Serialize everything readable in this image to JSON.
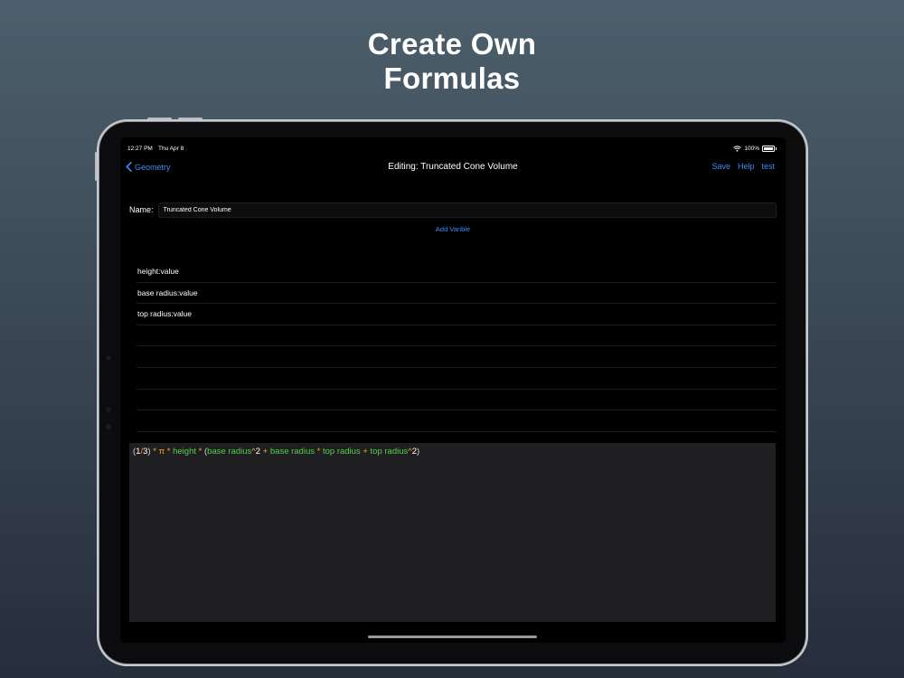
{
  "headline": {
    "line1": "Create Own",
    "line2": "Formulas"
  },
  "status_bar": {
    "time": "12:27 PM",
    "date": "Thu Apr 8",
    "battery": "100%"
  },
  "nav": {
    "back_label": "Geometry",
    "title": "Editing: Truncated Cone Volume",
    "actions": {
      "save": "Save",
      "help": "Help",
      "test": "test"
    }
  },
  "form": {
    "name_label": "Name:",
    "name_value": "Truncated Cone Volume",
    "add_variable": "Add Varible"
  },
  "variables": [
    {
      "label": "height:value"
    },
    {
      "label": "base radius:value"
    },
    {
      "label": "top radius:value"
    },
    {
      "label": ""
    },
    {
      "label": ""
    },
    {
      "label": ""
    },
    {
      "label": ""
    },
    {
      "label": ""
    }
  ],
  "formula": {
    "tokens": [
      {
        "text": "(",
        "kind": "paren"
      },
      {
        "text": "1",
        "kind": "num"
      },
      {
        "text": "/",
        "kind": "op"
      },
      {
        "text": "3",
        "kind": "num"
      },
      {
        "text": ")",
        "kind": "paren"
      },
      {
        "text": " * ",
        "kind": "op"
      },
      {
        "text": "π",
        "kind": "op"
      },
      {
        "text": " * ",
        "kind": "op"
      },
      {
        "text": "height",
        "kind": "var"
      },
      {
        "text": " * ",
        "kind": "op"
      },
      {
        "text": "(",
        "kind": "paren"
      },
      {
        "text": "base radius",
        "kind": "var"
      },
      {
        "text": "^",
        "kind": "op"
      },
      {
        "text": "2",
        "kind": "num"
      },
      {
        "text": " + ",
        "kind": "op"
      },
      {
        "text": "base radius",
        "kind": "var"
      },
      {
        "text": " * ",
        "kind": "op"
      },
      {
        "text": "top radius",
        "kind": "var"
      },
      {
        "text": " + ",
        "kind": "op"
      },
      {
        "text": "top radius",
        "kind": "var"
      },
      {
        "text": "^",
        "kind": "op"
      },
      {
        "text": "2",
        "kind": "num"
      },
      {
        "text": ")",
        "kind": "paren"
      }
    ]
  },
  "colors": {
    "accent": "#3d8cf6",
    "operator": "#f6a623",
    "variable": "#53d14b",
    "number": "#ffffff"
  },
  "icons": {
    "back": "chevron-left-icon",
    "wifi": "wifi-icon",
    "battery": "battery-icon"
  }
}
